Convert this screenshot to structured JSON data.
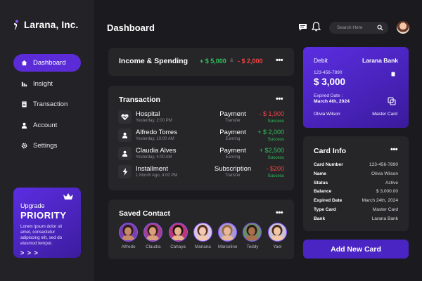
{
  "brand": {
    "name": "Larana, Inc."
  },
  "nav": {
    "items": [
      {
        "label": "Dashboard",
        "icon": "home-icon",
        "active": true
      },
      {
        "label": "Insight",
        "icon": "chart-icon"
      },
      {
        "label": "Transaction",
        "icon": "document-icon"
      },
      {
        "label": "Account",
        "icon": "user-icon"
      },
      {
        "label": "Settings",
        "icon": "gear-icon"
      }
    ]
  },
  "promo": {
    "upgrade": "Upgrade",
    "title": "PRIORITY",
    "description": "Lorem ipsum dolor sit amet, consectetur adipiscing elit, sed do eiusmod tempor.",
    "arrows": "> > >"
  },
  "header": {
    "title": "Dashboard",
    "search_placeholder": "Search Here"
  },
  "income": {
    "title": "Income & Spending",
    "income": "+ $ 5,000",
    "separator": "&",
    "spending": "- $ 2,000"
  },
  "transactions": {
    "title": "Transaction",
    "rows": [
      {
        "name": "Hospital",
        "date": "Yesterday, 2:00 PM",
        "type": "Payment",
        "sub": "Transfer",
        "amount": "- $ 1,900",
        "status": "Success",
        "icon": "heart-icon",
        "sign": "neg"
      },
      {
        "name": "Alfredo Torres",
        "date": "Yesterday, 10:00 AM",
        "type": "Payment",
        "sub": "Earning",
        "amount": "+ $ 2,000",
        "status": "Success",
        "icon": "user-icon",
        "sign": "pos"
      },
      {
        "name": "Claudia Alves",
        "date": "Yesterday, 4:00 AM",
        "type": "Payment",
        "sub": "Earning",
        "amount": "+ $2,500",
        "status": "Success",
        "icon": "user-icon",
        "sign": "pos"
      },
      {
        "name": "Installment",
        "date": "1 Month Ago, 4:00 PM",
        "type": "Subscription",
        "sub": "Transfer",
        "amount": "- $200",
        "status": "Success",
        "icon": "bolt-icon",
        "sign": "neg"
      }
    ]
  },
  "saved_contact": {
    "title": "Saved Contact",
    "contacts": [
      {
        "name": "Alfredo",
        "skin": "#c58a68",
        "hair": "#2a1b14",
        "bg": "#7b3fb0"
      },
      {
        "name": "Claudia",
        "skin": "#d9a07c",
        "hair": "#3a1e12",
        "bg": "#a0428f"
      },
      {
        "name": "Cahaya",
        "skin": "#e6b38e",
        "hair": "#1d120c",
        "bg": "#b9367a"
      },
      {
        "name": "Mariana",
        "skin": "#f2c9b0",
        "hair": "#5a2e1c",
        "bg": "#d7c6e8"
      },
      {
        "name": "Marceline",
        "skin": "#e8b89a",
        "hair": "#9a6a3c",
        "bg": "#a69ad6"
      },
      {
        "name": "Teddy",
        "skin": "#a86f4e",
        "hair": "#2b1a10",
        "bg": "#6b8e6a"
      },
      {
        "name": "Yael",
        "skin": "#f0c7a8",
        "hair": "#4a2a18",
        "bg": "#c9c2d6"
      }
    ]
  },
  "debit_card": {
    "label": "Debit",
    "bank": "Larana Bank",
    "number": "123-456-7890",
    "balance": "$ 3,000",
    "expired_label": "Expired Date :",
    "expired_date": "March 4th, 2024",
    "holder": "Olivia Wilson",
    "network": "Master Card"
  },
  "card_info": {
    "title": "Card Info",
    "rows": [
      {
        "k": "Card Number",
        "v": "123-456-7890"
      },
      {
        "k": "Name",
        "v": "Olivia Wilson"
      },
      {
        "k": "Status",
        "v": "Active"
      },
      {
        "k": "Balance",
        "v": "$ 3,000.00"
      },
      {
        "k": "Expired Date",
        "v": "March 24th, 2024"
      },
      {
        "k": "Type Card",
        "v": "Master Card"
      },
      {
        "k": "Bank",
        "v": "Larana Bank"
      }
    ]
  },
  "actions": {
    "add_card": "Add New Card"
  },
  "colors": {
    "accent": "#5a2bd6",
    "positive": "#30c25c",
    "negative": "#ef4444",
    "background": "#1b1b1f",
    "card": "#262629"
  }
}
